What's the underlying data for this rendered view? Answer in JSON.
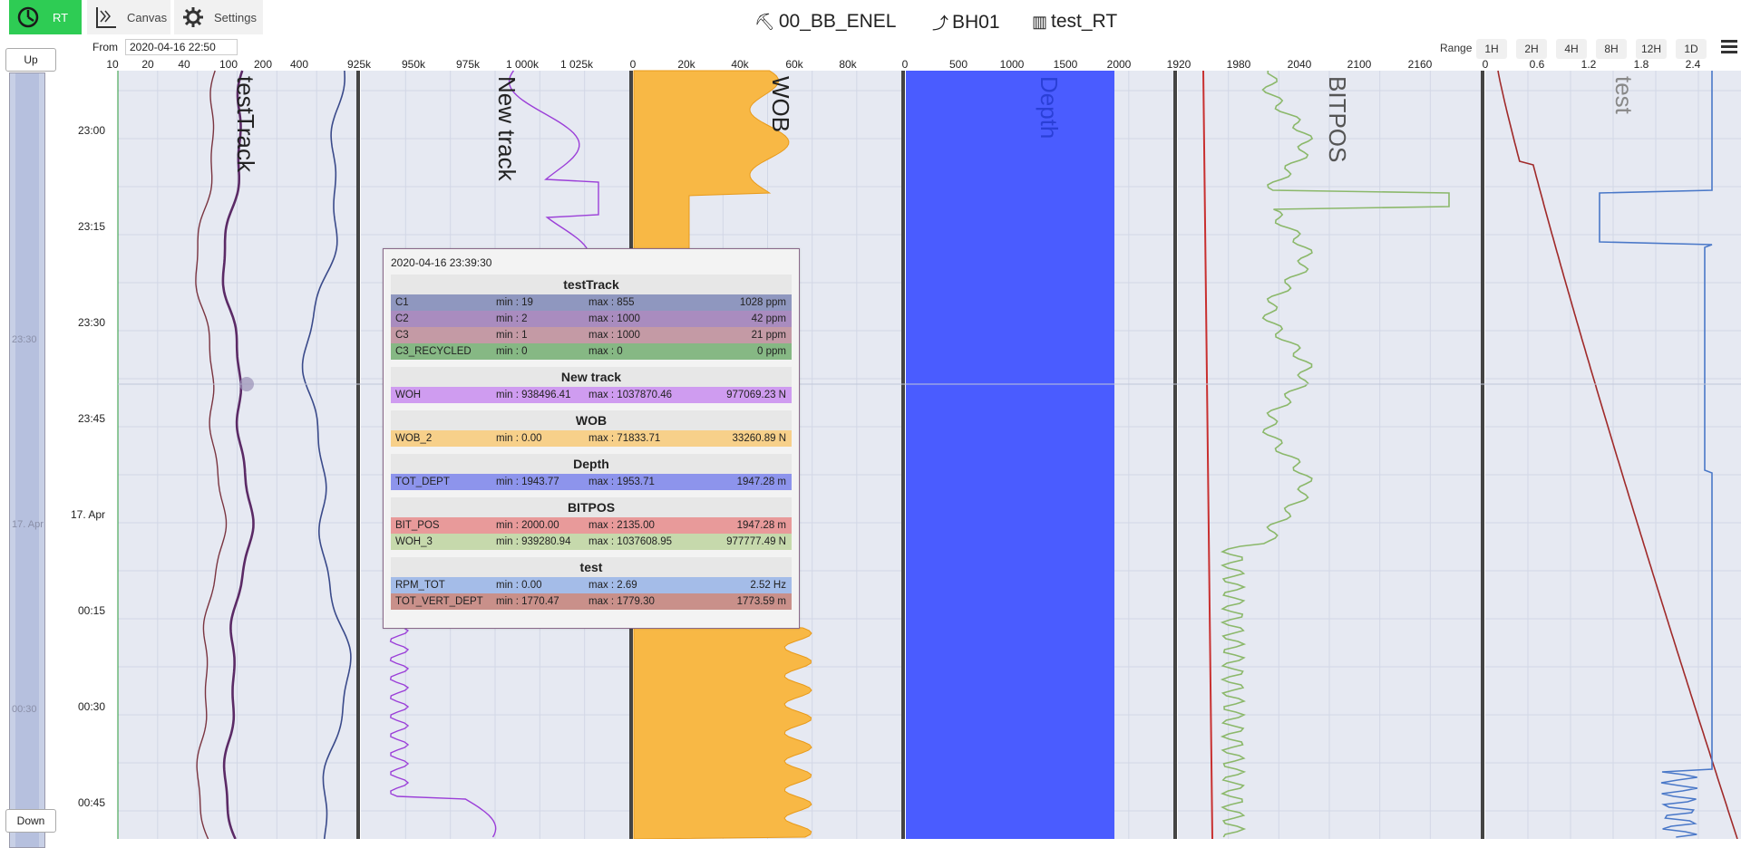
{
  "toolbar": {
    "rt_label": "RT",
    "canvas_label": "Canvas",
    "settings_label": "Settings",
    "rt_color": "#2ecc54"
  },
  "header": {
    "rig": "00_BB_ENEL",
    "well": "BH01",
    "dataset": "test_RT"
  },
  "from": {
    "label": "From",
    "value": "2020-04-16 22:50"
  },
  "range": {
    "label": "Range",
    "options": [
      "1H",
      "2H",
      "4H",
      "8H",
      "12H",
      "1D"
    ]
  },
  "nav": {
    "up": "Up",
    "down": "Down",
    "overview_labels": [
      "23:30",
      "17. Apr",
      "00:30"
    ]
  },
  "time_axis": [
    "23:00",
    "23:15",
    "23:30",
    "23:45",
    "17. Apr",
    "00:15",
    "00:30",
    "00:45"
  ],
  "tracks": [
    {
      "title": "testTrack",
      "scale": [
        "10",
        "20",
        "40",
        "100",
        "200",
        "400"
      ],
      "color": "#222"
    },
    {
      "title": "New track",
      "scale": [
        "925k",
        "950k",
        "975k",
        "1 000k",
        "1 025k"
      ],
      "color": "#222"
    },
    {
      "title": "WOB",
      "scale": [
        "0",
        "20k",
        "40k",
        "60k",
        "80k"
      ],
      "color": "#222"
    },
    {
      "title": "Depth",
      "scale": [
        "0",
        "500",
        "1000",
        "1500",
        "2000"
      ],
      "color": "#2a3fd6"
    },
    {
      "title": "BITPOS",
      "scale": [
        "1920",
        "1980",
        "2040",
        "2100",
        "2160"
      ],
      "color": "#555"
    },
    {
      "title": "test",
      "scale": [
        "0",
        "0.6",
        "1.2",
        "1.8",
        "2.4"
      ],
      "color": "#888"
    }
  ],
  "colors": {
    "track_bg": "#e6e9f2",
    "grid": "#ffffff",
    "wob_fill": "#f8b845",
    "depth_fill": "#4a5cff",
    "c1": "#3a4a8a",
    "c2": "#5b2a66",
    "c3": "#7a3440",
    "woh": "#9b3fd8",
    "bitpos": "#8bb86a",
    "bit_pos": "#c83030",
    "rpm": "#4a78c8",
    "tvd": "#a02a2a"
  },
  "tooltip": {
    "time": "2020-04-16 23:39:30",
    "groups": [
      {
        "title": "testTrack",
        "rows": [
          {
            "name": "C1",
            "min": "min : 19",
            "max": "max : 855",
            "value": "1028 ppm",
            "bg": "#8f97bf"
          },
          {
            "name": "C2",
            "min": "min : 2",
            "max": "max : 1000",
            "value": "42 ppm",
            "bg": "#a98cbf"
          },
          {
            "name": "C3",
            "min": "min : 1",
            "max": "max : 1000",
            "value": "21 ppm",
            "bg": "#c49aa5"
          },
          {
            "name": "C3_RECYCLED",
            "min": "min : 0",
            "max": "max : 0",
            "value": "0 ppm",
            "bg": "#86b884"
          }
        ]
      },
      {
        "title": "New track",
        "rows": [
          {
            "name": "WOH",
            "min": "min : 938496.41",
            "max": "max : 1037870.46",
            "value": "977069.23 N",
            "bg": "#cf9cf0"
          }
        ]
      },
      {
        "title": "WOB",
        "rows": [
          {
            "name": "WOB_2",
            "min": "min : 0.00",
            "max": "max : 71833.71",
            "value": "33260.89 N",
            "bg": "#f7d08a"
          }
        ]
      },
      {
        "title": "Depth",
        "rows": [
          {
            "name": "TOT_DEPT",
            "min": "min : 1943.77",
            "max": "max : 1953.71",
            "value": "1947.28 m",
            "bg": "#8d94ec"
          }
        ]
      },
      {
        "title": "BITPOS",
        "rows": [
          {
            "name": "BIT_POS",
            "min": "min : 2000.00",
            "max": "max : 2135.00",
            "value": "1947.28 m",
            "bg": "#e89a9a"
          },
          {
            "name": "WOH_3",
            "min": "min : 939280.94",
            "max": "max : 1037608.95",
            "value": "977777.49 N",
            "bg": "#c6d9ac"
          }
        ]
      },
      {
        "title": "test",
        "rows": [
          {
            "name": "RPM_TOT",
            "min": "min : 0.00",
            "max": "max : 2.69",
            "value": "2.52 Hz",
            "bg": "#a4bce8"
          },
          {
            "name": "TOT_VERT_DEPT",
            "min": "min : 1770.47",
            "max": "max : 1779.30",
            "value": "1773.59 m",
            "bg": "#c9908a"
          }
        ]
      }
    ]
  }
}
